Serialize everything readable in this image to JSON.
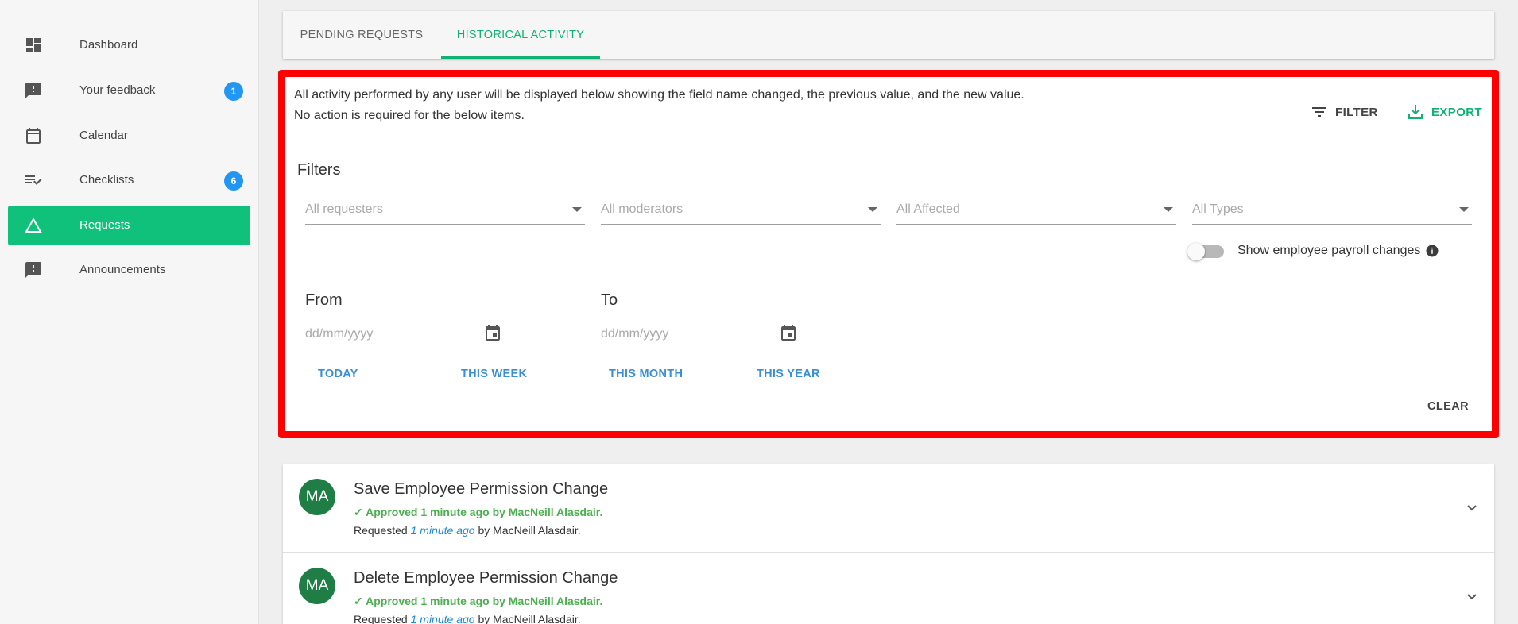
{
  "sidebar": {
    "items": [
      {
        "label": "Dashboard",
        "icon": "dashboard-icon"
      },
      {
        "label": "Your feedback",
        "icon": "feedback-icon",
        "badge": "1"
      },
      {
        "label": "Calendar",
        "icon": "calendar-icon"
      },
      {
        "label": "Checklists",
        "icon": "checklist-icon",
        "badge": "6"
      },
      {
        "label": "Requests",
        "icon": "triangle-icon",
        "active": true
      },
      {
        "label": "Announcements",
        "icon": "announcement-icon"
      }
    ]
  },
  "tabs": [
    {
      "label": "PENDING REQUESTS"
    },
    {
      "label": "HISTORICAL ACTIVITY",
      "active": true
    }
  ],
  "panel": {
    "intro_line1": "All activity performed by any user will be displayed below showing the field name changed, the previous value, and the new value.",
    "intro_line2": "No action is required for the below items.",
    "filter_label": "FILTER",
    "export_label": "EXPORT",
    "filters_title": "Filters",
    "selects": [
      {
        "placeholder": "All requesters"
      },
      {
        "placeholder": "All moderators"
      },
      {
        "placeholder": "All Affected"
      },
      {
        "placeholder": "All Types"
      }
    ],
    "toggle_label": "Show employee payroll changes",
    "toggle_on": false,
    "from_label": "From",
    "to_label": "To",
    "date_placeholder": "dd/mm/yyyy",
    "quick_ranges": [
      "TODAY",
      "THIS WEEK",
      "THIS MONTH",
      "THIS YEAR"
    ],
    "clear_label": "CLEAR"
  },
  "requests": [
    {
      "initials": "MA",
      "title": "Save Employee Permission Change",
      "status": "Approved 1 minute ago by MacNeill Alasdair.",
      "requested_prefix": "Requested",
      "requested_time": "1 minute ago",
      "requested_by": "by MacNeill Alasdair."
    },
    {
      "initials": "MA",
      "title": "Delete Employee Permission Change",
      "status": "Approved 1 minute ago by MacNeill Alasdair.",
      "requested_prefix": "Requested",
      "requested_time": "1 minute ago",
      "requested_by": "by MacNeill Alasdair."
    }
  ],
  "colors": {
    "accent": "#10c17c",
    "badge": "#2196f3",
    "highlight": "#ff0000",
    "link": "#3a8fd4",
    "avatar": "#1e7e45",
    "approved": "#4caf50"
  }
}
